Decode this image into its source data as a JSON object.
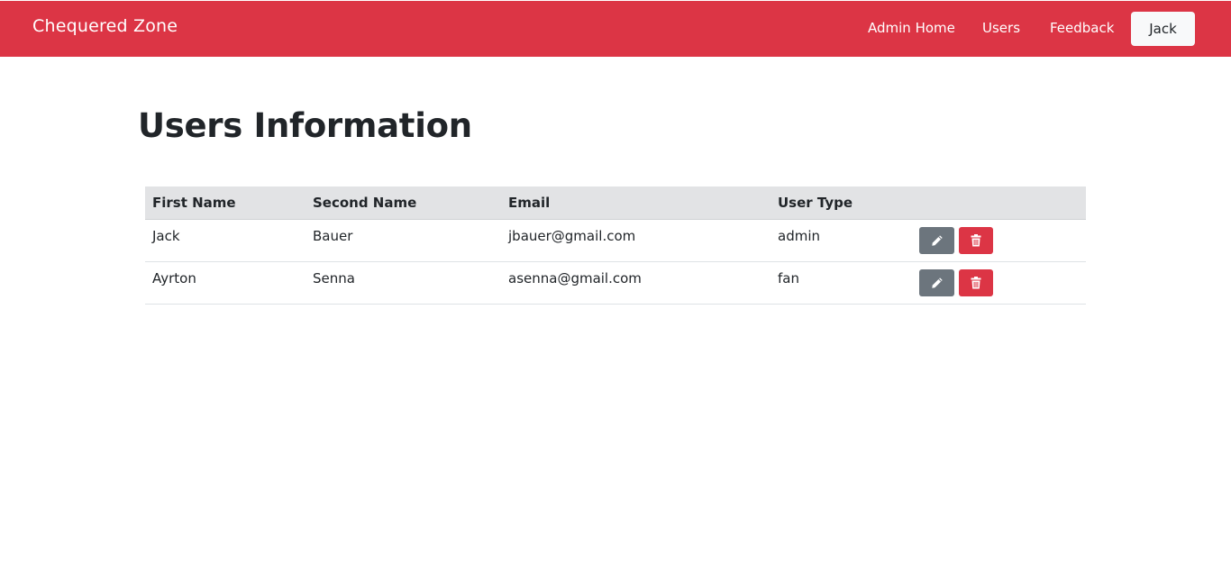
{
  "navbar": {
    "brand": "Chequered Zone",
    "links": [
      "Admin Home",
      "Users",
      "Feedback"
    ],
    "user_button": "Jack"
  },
  "page": {
    "title": "Users Information"
  },
  "table": {
    "headers": [
      "First Name",
      "Second Name",
      "Email",
      "User Type",
      ""
    ],
    "rows": [
      {
        "first": "Jack",
        "second": "Bauer",
        "email": "jbauer@gmail.com",
        "type": "admin"
      },
      {
        "first": "Ayrton",
        "second": "Senna",
        "email": "asenna@gmail.com",
        "type": "fan"
      }
    ],
    "row_actions": [
      "pencil-icon",
      "trash-icon"
    ]
  },
  "colors": {
    "navbar": "#dc3545",
    "edit_button": "#6c757d",
    "delete_button": "#dc3545",
    "table_header": "#e2e3e5"
  }
}
